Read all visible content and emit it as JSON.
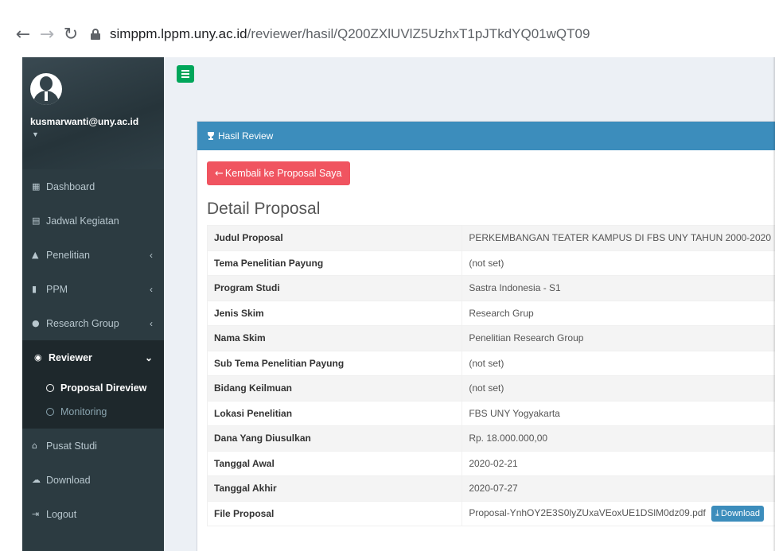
{
  "browser": {
    "url_host": "simppm.lppm.uny.ac.id",
    "url_path": "/reviewer/hasil/Q200ZXlUVlZ5UzhxT1pJTkdYQ01wQT09"
  },
  "user": {
    "email": "kusmarwanti@uny.ac.id"
  },
  "sidebar": {
    "items": [
      {
        "label": "Dashboard",
        "icon": "dashboard-icon"
      },
      {
        "label": "Jadwal Kegiatan",
        "icon": "calendar-icon"
      },
      {
        "label": "Penelitian",
        "icon": "flask-icon"
      },
      {
        "label": "PPM",
        "icon": "binoculars-icon"
      },
      {
        "label": "Research Group",
        "icon": "users-icon"
      },
      {
        "label": "Reviewer",
        "icon": "eye-icon"
      },
      {
        "label": "Pusat Studi",
        "icon": "institution-icon"
      },
      {
        "label": "Download",
        "icon": "cloud-download-icon"
      },
      {
        "label": "Logout",
        "icon": "sign-out-icon"
      }
    ],
    "reviewer_sub": [
      {
        "label": "Proposal Direview"
      },
      {
        "label": "Monitoring"
      }
    ]
  },
  "panel": {
    "header_title": "Hasil Review",
    "back_button": "Kembali ke Proposal Saya",
    "section_title": "Detail Proposal",
    "rows": [
      {
        "label": "Judul Proposal",
        "value": "PERKEMBANGAN TEATER KAMPUS DI FBS UNY TAHUN 2000-2020"
      },
      {
        "label": "Tema Penelitian Payung",
        "value": "(not set)"
      },
      {
        "label": "Program Studi",
        "value": "Sastra Indonesia - S1"
      },
      {
        "label": "Jenis Skim",
        "value": "Research Grup"
      },
      {
        "label": "Nama Skim",
        "value": "Penelitian Research Group"
      },
      {
        "label": "Sub Tema Penelitian Payung",
        "value": "(not set)"
      },
      {
        "label": "Bidang Keilmuan",
        "value": "(not set)"
      },
      {
        "label": "Lokasi Penelitian",
        "value": "FBS UNY Yogyakarta"
      },
      {
        "label": "Dana Yang Diusulkan",
        "value": "Rp. 18.000.000,00"
      },
      {
        "label": "Tanggal Awal",
        "value": "2020-02-21"
      },
      {
        "label": "Tanggal Akhir",
        "value": "2020-07-27"
      },
      {
        "label": "File Proposal",
        "value": "Proposal-YnhOY2E3S0lyZUxaVEoxUE1DSlM0dz09.pdf"
      }
    ],
    "download_button": "Download"
  },
  "colors": {
    "sidebar_bg": "#2c3b41",
    "header_blue": "#3c8dbc",
    "back_button_red": "#f05460",
    "toggle_green": "#00a65a"
  }
}
